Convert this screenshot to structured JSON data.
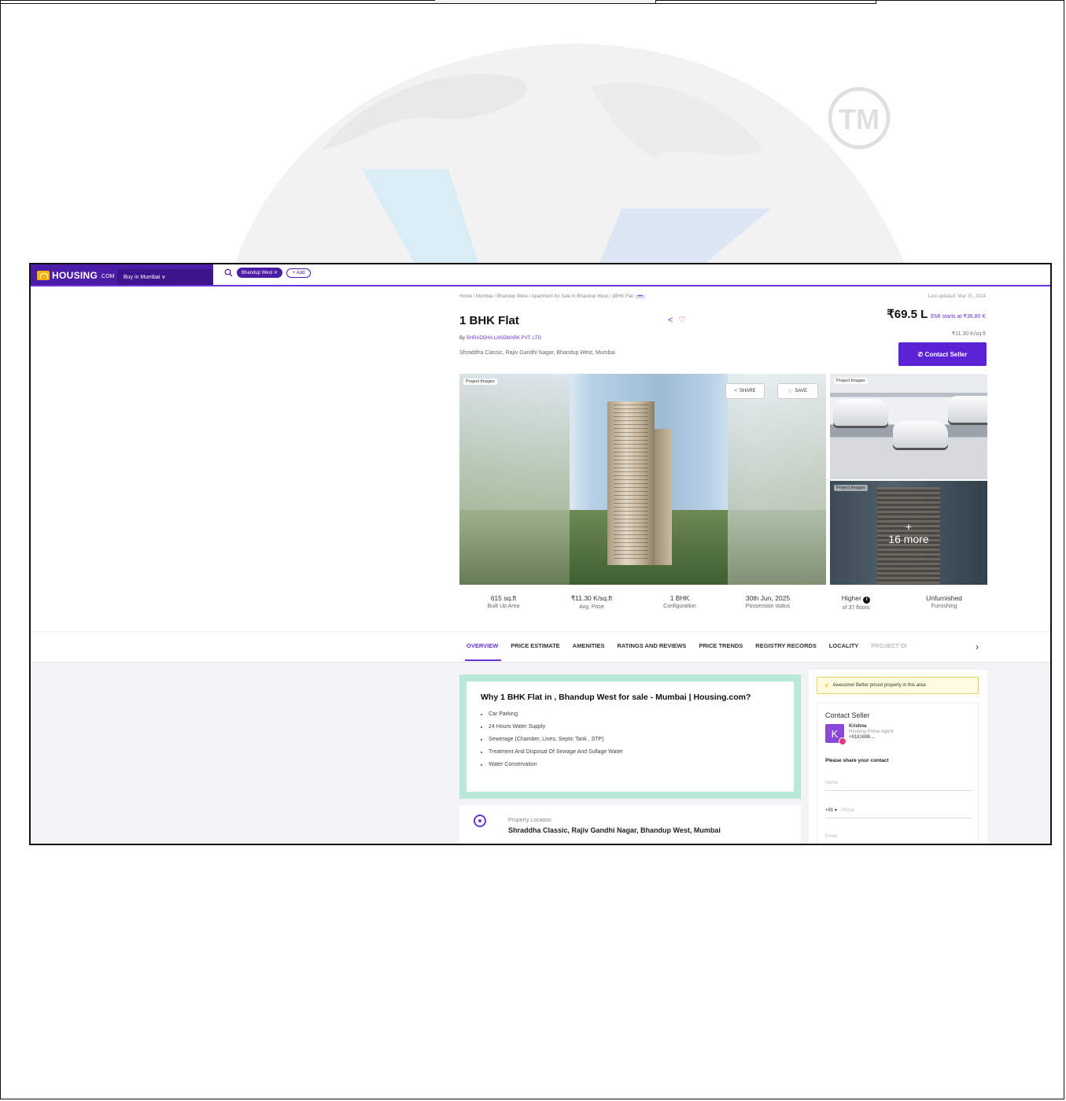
{
  "header": {
    "logo_text": "HOUSING",
    "logo_suffix": ".COM",
    "buy_selector": "Buy in Mumbai ∨",
    "search_chip": "Bhandup West ✕",
    "add_chip": "+ Add"
  },
  "breadcrumb": {
    "text": "Home / Mumbai / Bhandup West / Apartment for Sale in Bhandup West / 1BHK Flat",
    "more": "•••"
  },
  "last_updated": "Last updated: Mar 31, 2024",
  "listing": {
    "title": "1 BHK Flat",
    "by_prefix": "By ",
    "developer": "SHRADDHA LANDMARK PVT. LTD",
    "address": "Shraddha Classic, Rajiv Gandhi Nagar, Bhandup West, Mumbai",
    "price": "₹69.5 L",
    "emi": "EMI starts at ₹36.80 K",
    "price_per_sqft": "₹11.30 K/sq.ft",
    "contact_button": "✆ Contact Seller"
  },
  "gallery": {
    "main_label": "Project Images",
    "share_label": "SHARE",
    "save_label": "SAVE",
    "top_right_label": "Project Images",
    "bottom_right_label": "Project Images",
    "more_plus": "+",
    "more_text": "16 more"
  },
  "stats": [
    {
      "value": "615 sq.ft",
      "label": "Built Up Area"
    },
    {
      "value": "₹11.30 K/sq.ft",
      "label": "Avg. Price"
    },
    {
      "value": "1 BHK",
      "label": "Configuration"
    },
    {
      "value": "30th Jun, 2025",
      "label": "Possession status"
    },
    {
      "value": "Higher",
      "label": "of 37 floors"
    },
    {
      "value": "Unfurnished",
      "label": "Furnishing"
    }
  ],
  "tabs": [
    "OVERVIEW",
    "PRICE ESTIMATE",
    "AMENITIES",
    "RATINGS AND REVIEWS",
    "PRICE TRENDS",
    "REGISTRY RECORDS",
    "LOCALITY",
    "PROJECT OI"
  ],
  "why": {
    "heading": "Why 1 BHK Flat in , Bhandup West for sale - Mumbai | Housing.com?",
    "items": [
      "Car Parking",
      "24 Hours Water Supply",
      "Sewerage (Chamber, Lines, Septic Tank , STP)",
      "Treatment And Disposal Of Sewage And Sullage Water",
      "Water Conservation"
    ]
  },
  "location": {
    "label": "Property Location",
    "value": "Shraddha Classic, Rajiv Gandhi Nagar, Bhandup West, Mumbai"
  },
  "sidebar": {
    "alert": "Awesome! Better priced property in this area",
    "contact_title": "Contact Seller",
    "agent_initial": "K",
    "agent_name": "Krishna",
    "agent_role": "Housing Prime Agent",
    "agent_phone": "+9181698....",
    "share_prompt": "Please share your contact",
    "name_placeholder": "Name",
    "country_code": "+91 ▾",
    "phone_placeholder": "Phone",
    "email_placeholder": "Email"
  },
  "watermark": {
    "tm": "TM"
  },
  "colors": {
    "brand": "#6a32d8",
    "header_dark": "#4b1ca6",
    "why_border": "#b9ead8",
    "logo_yellow": "#f9b200"
  }
}
